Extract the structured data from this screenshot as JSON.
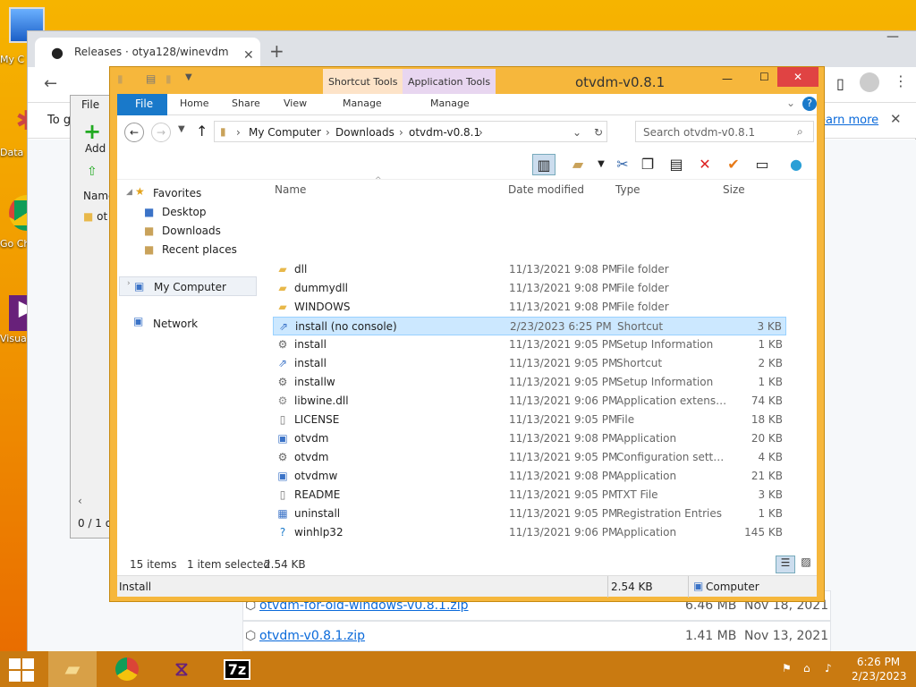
{
  "desktop": {
    "icons": [
      {
        "label": "My C",
        "name": "my-computer-desktop-icon"
      },
      {
        "label": "Data",
        "name": "datavault-desktop-icon"
      },
      {
        "label": "Go Ch",
        "name": "google-chrome-desktop-icon"
      },
      {
        "label": "Visua",
        "name": "visual-studio-desktop-icon"
      }
    ]
  },
  "chrome": {
    "tab_title": "Releases · otya128/winevdm",
    "info_prefix": "To g",
    "learn_more": "earn more",
    "releases": [
      {
        "name": "otvdm-for-old-windows-v0.8.1.zip",
        "size": "6.46 MB",
        "date": "Nov 18, 2021"
      },
      {
        "name": "otvdm-v0.8.1.zip",
        "size": "1.41 MB",
        "date": "Nov 13, 2021"
      }
    ]
  },
  "zip": {
    "menu_file": "File",
    "add_label": "Add",
    "col_name": "Name",
    "item": "ot",
    "status": "0 / 1 o"
  },
  "explorer": {
    "title": "otvdm-v0.8.1",
    "context_tools": [
      {
        "label": "Shortcut Tools",
        "tab": "Manage"
      },
      {
        "label": "Application Tools",
        "tab": "Manage"
      }
    ],
    "ribbon_tabs": [
      "File",
      "Home",
      "Share",
      "View"
    ],
    "breadcrumb": [
      "My Computer",
      "Downloads",
      "otvdm-v0.8.1"
    ],
    "search_placeholder": "Search otvdm-v0.8.1",
    "tree": {
      "favorites": "Favorites",
      "fav_items": [
        "Desktop",
        "Downloads",
        "Recent places"
      ],
      "computer": "My Computer",
      "network": "Network"
    },
    "columns": {
      "name": "Name",
      "date": "Date modified",
      "type": "Type",
      "size": "Size"
    },
    "files": [
      {
        "name": "dll",
        "date": "11/13/2021 9:08 PM",
        "type": "File folder",
        "size": "",
        "icon": "folder"
      },
      {
        "name": "dummydll",
        "date": "11/13/2021 9:08 PM",
        "type": "File folder",
        "size": "",
        "icon": "folder"
      },
      {
        "name": "WINDOWS",
        "date": "11/13/2021 9:08 PM",
        "type": "File folder",
        "size": "",
        "icon": "folder"
      },
      {
        "name": "install (no console)",
        "date": "2/23/2023 6:25 PM",
        "type": "Shortcut",
        "size": "3 KB",
        "icon": "shortcut",
        "selected": true
      },
      {
        "name": "install",
        "date": "11/13/2021 9:05 PM",
        "type": "Setup Information",
        "size": "1 KB",
        "icon": "settings"
      },
      {
        "name": "install",
        "date": "11/13/2021 9:05 PM",
        "type": "Shortcut",
        "size": "2 KB",
        "icon": "shortcut"
      },
      {
        "name": "installw",
        "date": "11/13/2021 9:05 PM",
        "type": "Setup Information",
        "size": "1 KB",
        "icon": "settings"
      },
      {
        "name": "libwine.dll",
        "date": "11/13/2021 9:06 PM",
        "type": "Application extens…",
        "size": "74 KB",
        "icon": "dll"
      },
      {
        "name": "LICENSE",
        "date": "11/13/2021 9:05 PM",
        "type": "File",
        "size": "18 KB",
        "icon": "file"
      },
      {
        "name": "otvdm",
        "date": "11/13/2021 9:08 PM",
        "type": "Application",
        "size": "20 KB",
        "icon": "app"
      },
      {
        "name": "otvdm",
        "date": "11/13/2021 9:05 PM",
        "type": "Configuration sett…",
        "size": "4 KB",
        "icon": "settings"
      },
      {
        "name": "otvdmw",
        "date": "11/13/2021 9:08 PM",
        "type": "Application",
        "size": "21 KB",
        "icon": "app"
      },
      {
        "name": "README",
        "date": "11/13/2021 9:05 PM",
        "type": "TXT File",
        "size": "3 KB",
        "icon": "file"
      },
      {
        "name": "uninstall",
        "date": "11/13/2021 9:05 PM",
        "type": "Registration Entries",
        "size": "1 KB",
        "icon": "reg"
      },
      {
        "name": "winhlp32",
        "date": "11/13/2021 9:06 PM",
        "type": "Application",
        "size": "145 KB",
        "icon": "help"
      }
    ],
    "status": {
      "items": "15 items",
      "selected": "1 item selected",
      "sel_size": "2.54 KB"
    },
    "details": {
      "name": "Install",
      "size": "2.54 KB",
      "location": "Computer"
    }
  },
  "taskbar": {
    "time": "6:26 PM",
    "date": "2/23/2023",
    "apps": [
      "file-explorer",
      "chrome",
      "visual-studio",
      "7zip"
    ],
    "zip_label": "7z"
  },
  "colors": {
    "accent": "#1979ca",
    "selection": "#cce8ff",
    "title_bar": "#f6b73c"
  }
}
